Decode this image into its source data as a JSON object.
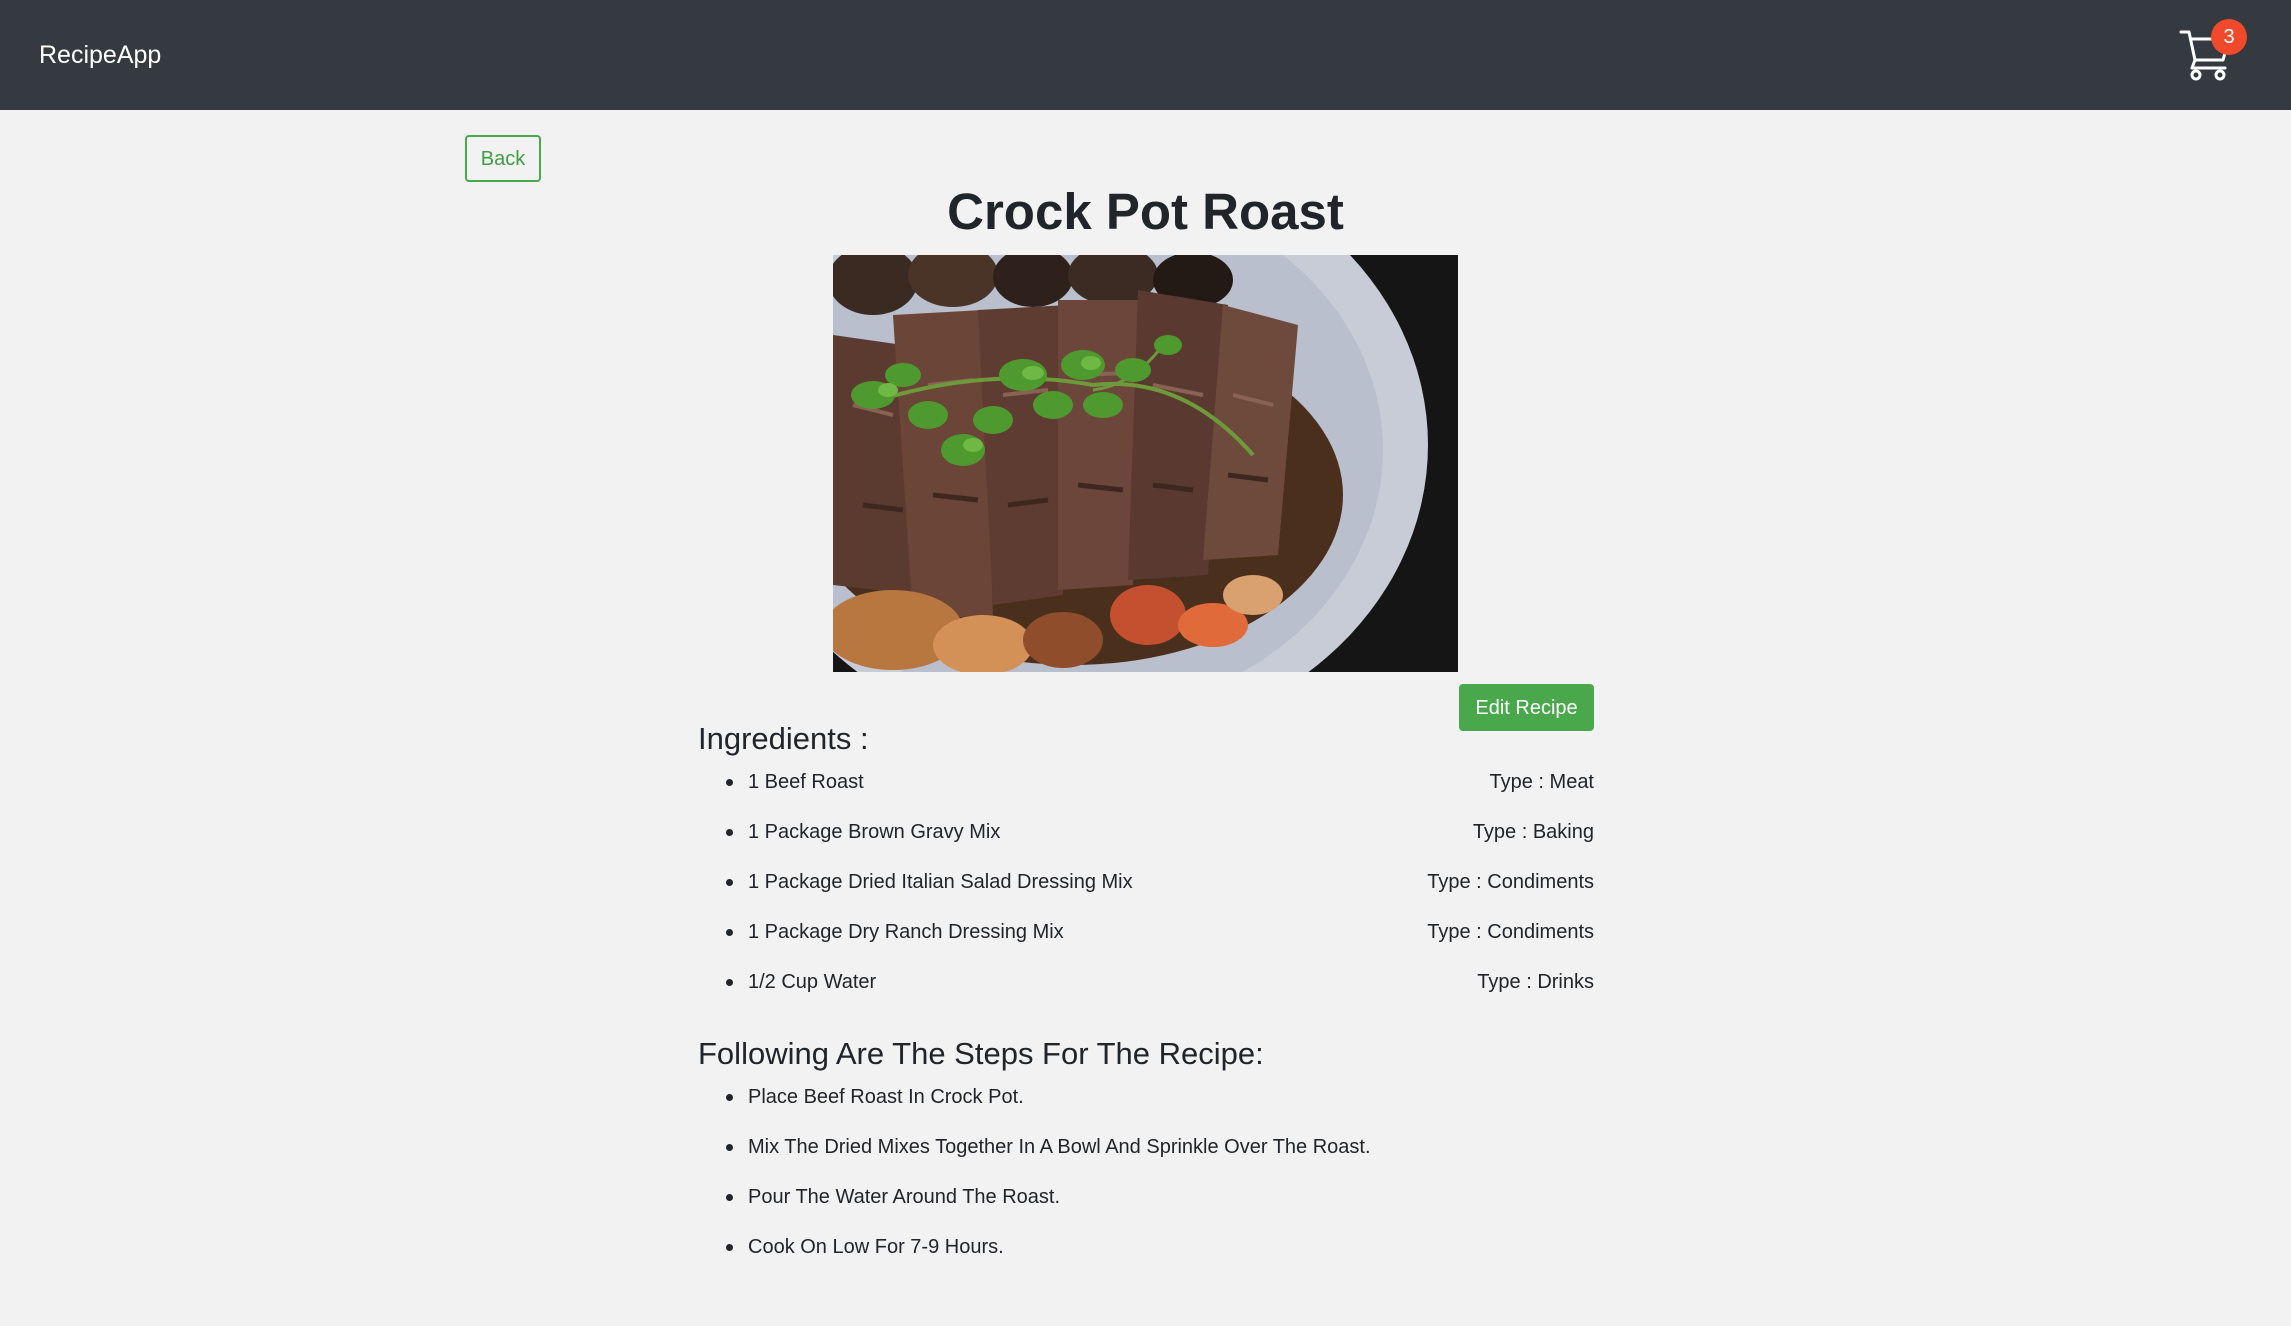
{
  "navbar": {
    "brand": "RecipeApp",
    "cart_icon": "shopping-cart-icon",
    "cart_count": "3"
  },
  "back_label": "Back",
  "recipe": {
    "title": "Crock Pot Roast",
    "edit_label": "Edit Recipe",
    "ingredients_heading": "Ingredients :",
    "ingredients": [
      {
        "name": "1 Beef Roast",
        "type": "Type : Meat"
      },
      {
        "name": "1 Package Brown Gravy Mix",
        "type": "Type : Baking"
      },
      {
        "name": "1 Package Dried Italian Salad Dressing Mix",
        "type": "Type : Condiments"
      },
      {
        "name": "1 Package Dry Ranch Dressing Mix",
        "type": "Type : Condiments"
      },
      {
        "name": "1/2 Cup Water",
        "type": "Type : Drinks"
      }
    ],
    "steps_heading": "Following Are The Steps For The Recipe:",
    "steps": [
      "Place Beef Roast In Crock Pot.",
      "Mix The Dried Mixes Together In A Bowl And Sprinkle Over The Roast.",
      "Pour The Water Around The Roast.",
      "Cook On Low For 7-9 Hours."
    ]
  },
  "colors": {
    "navbar_bg": "#343a40",
    "page_bg": "#f2f2f2",
    "accent_green": "#4aa84c",
    "badge_red": "#f0492b"
  }
}
